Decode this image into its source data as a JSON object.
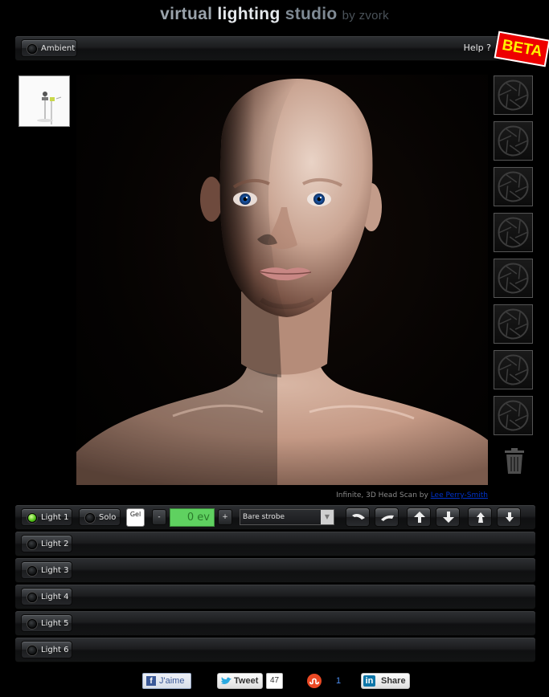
{
  "app": {
    "title_part1": "virtual",
    "title_part2": "lighting",
    "title_part3": "studio",
    "title_part4": "by zvork"
  },
  "topbar": {
    "ambient_label": "Ambient",
    "ambient_on": false,
    "help_label": "Help ?",
    "beta_label": "BETA"
  },
  "scene": {
    "caption_prefix": "Infinite, 3D Head Scan by",
    "caption_link": "Lee Perry-Smith"
  },
  "presets": {
    "slot_icon": "aperture-icon",
    "slot_count": 8,
    "delete_icon": "trash-icon"
  },
  "light1": {
    "label": "Light 1",
    "on": true,
    "solo_label": "Solo",
    "gel_label": "Gel",
    "minus_label": "-",
    "plus_label": "+",
    "ev_value": "0 ev",
    "type_value": "Bare strobe",
    "action_icons": [
      "rotate-left-icon",
      "rotate-right-icon",
      "move-up-icon",
      "move-down-icon",
      "move-forward-icon",
      "move-back-icon"
    ]
  },
  "lights": [
    {
      "label": "Light 2",
      "on": false
    },
    {
      "label": "Light 3",
      "on": false
    },
    {
      "label": "Light 4",
      "on": false
    },
    {
      "label": "Light 5",
      "on": false
    },
    {
      "label": "Light 6",
      "on": false
    }
  ],
  "social": {
    "facebook_label": "J'aime",
    "tweet_label": "Tweet",
    "tweet_count": "47",
    "stumble_count": "1",
    "linkedin_label": "Share"
  },
  "colors": {
    "ev_green": "#5fd160",
    "led_on": "#52c21a",
    "beta_red": "#ee0000",
    "beta_yellow": "#fff200"
  }
}
